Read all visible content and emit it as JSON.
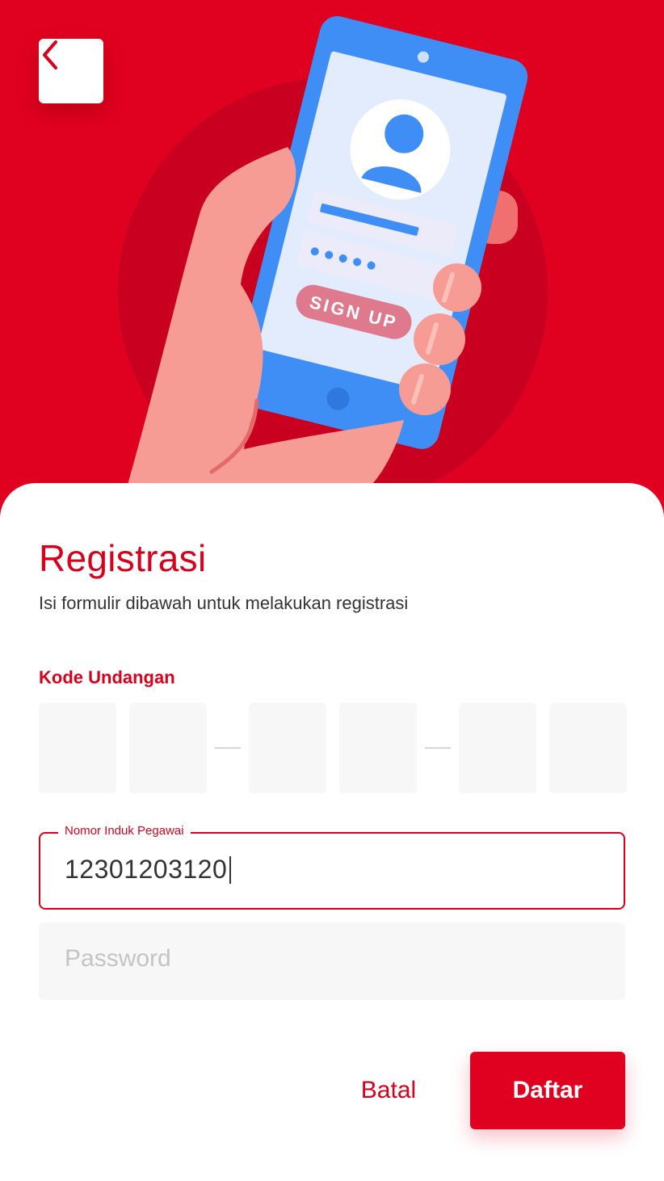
{
  "colors": {
    "primary": "#e0001f",
    "accent_text": "#d8001c",
    "field_bg": "#f7f7f7"
  },
  "header": {
    "back_icon": "chevron-left-icon",
    "illustration": {
      "button_text": "SIGN UP"
    }
  },
  "form": {
    "title": "Registrasi",
    "subtitle": "Isi formulir dibawah untuk melakukan registrasi",
    "invite_code": {
      "label": "Kode Undangan",
      "digits": [
        "",
        "",
        "",
        "",
        "",
        ""
      ]
    },
    "employee_id": {
      "label": "Nomor Induk Pegawai",
      "value": "12301203120"
    },
    "password": {
      "placeholder": "Password",
      "value": ""
    }
  },
  "actions": {
    "cancel_label": "Batal",
    "submit_label": "Daftar"
  }
}
